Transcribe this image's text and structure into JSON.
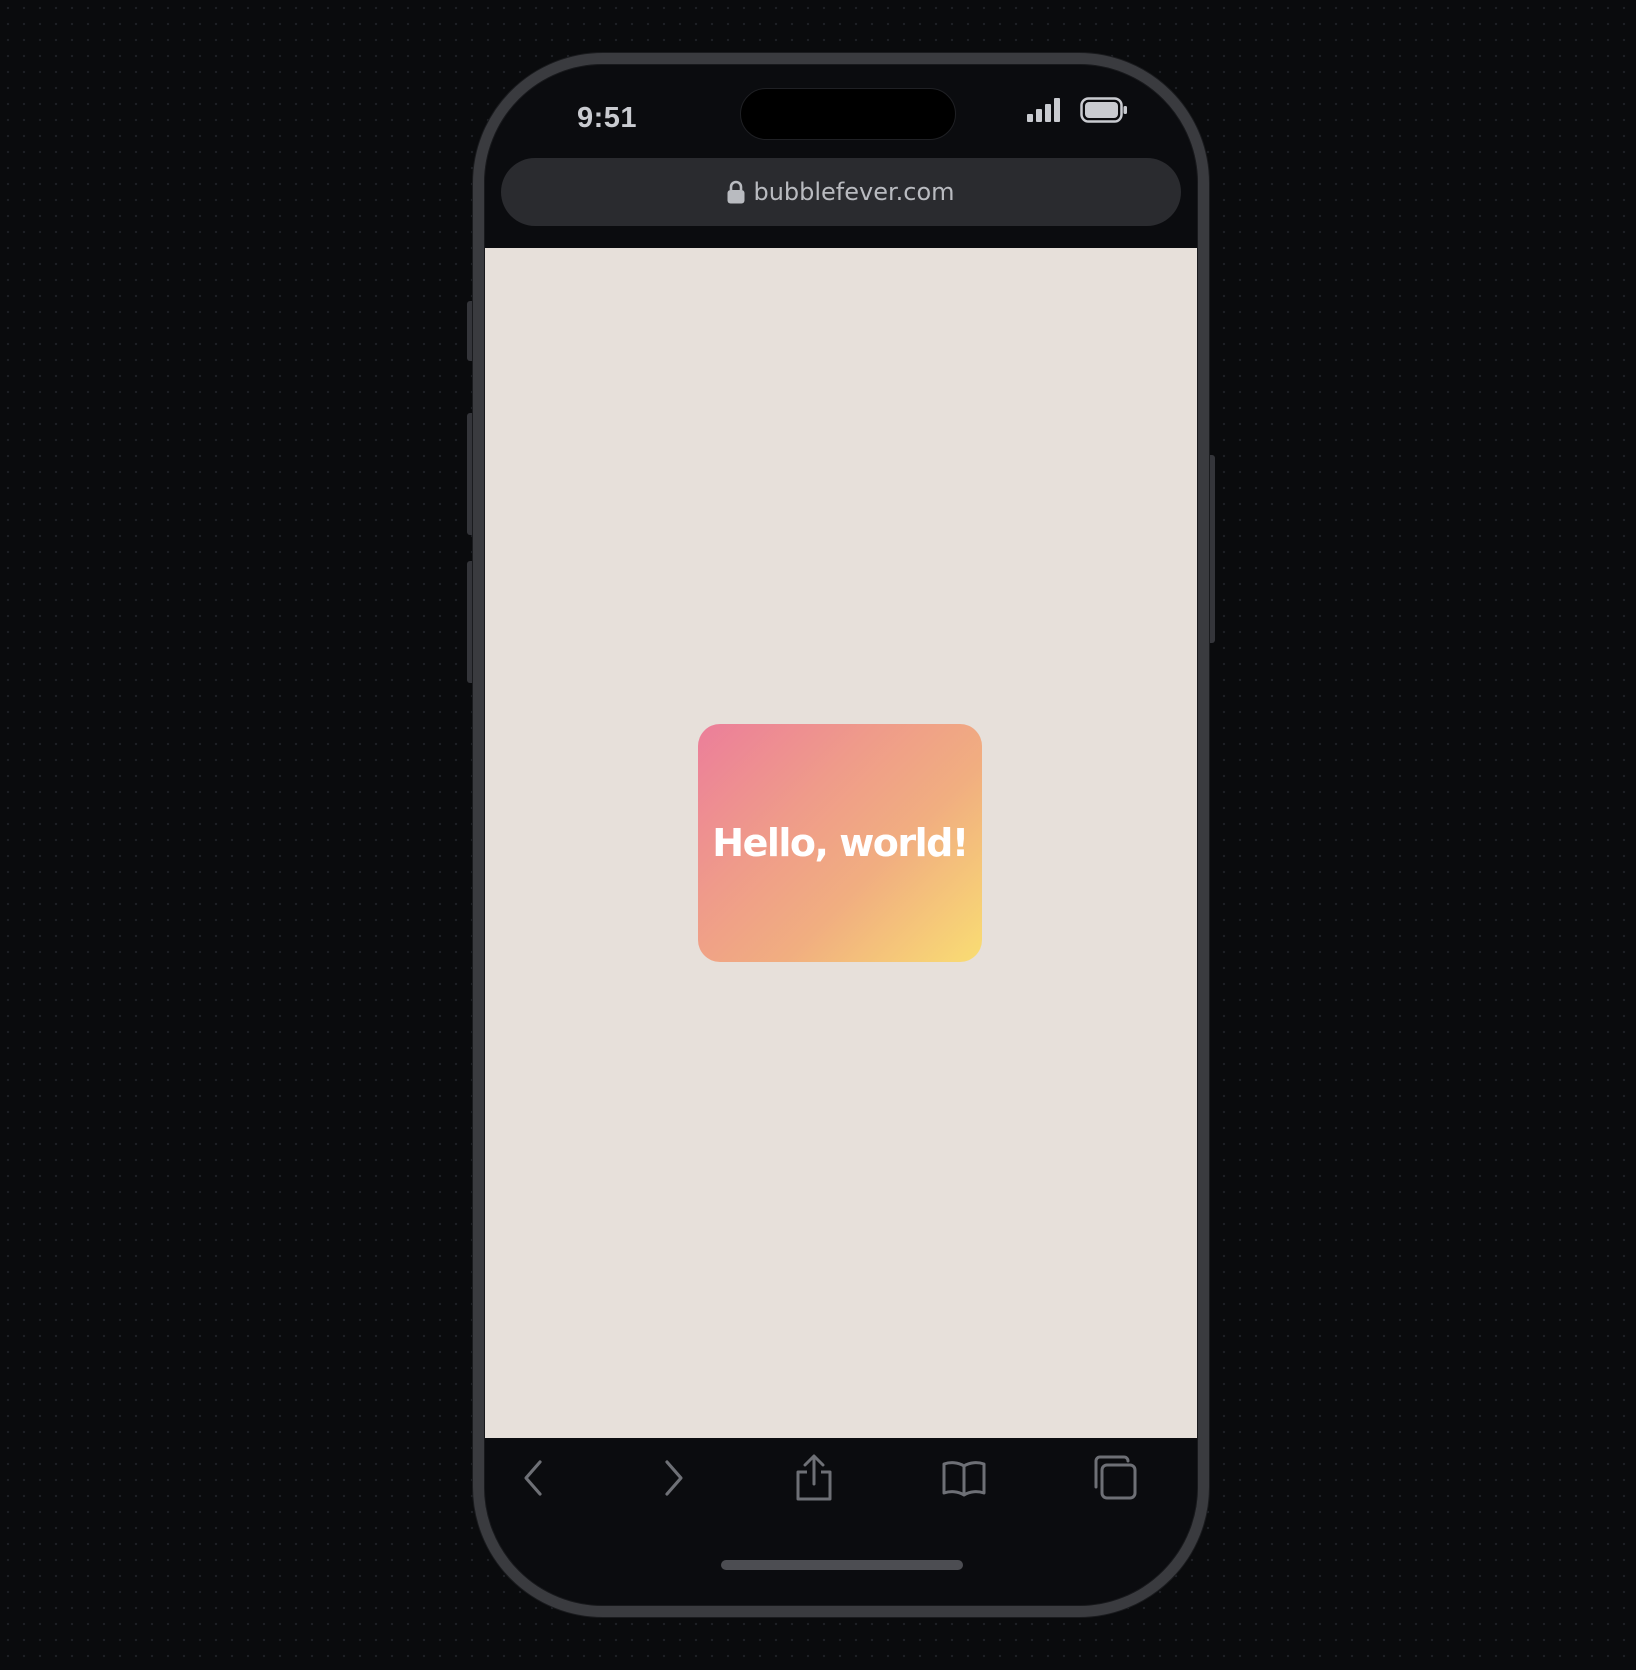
{
  "status_bar": {
    "time": "9:51",
    "signal_icon": "cellular-signal-icon",
    "battery_icon": "battery-icon"
  },
  "browser": {
    "url": "bubblefever.com",
    "lock_icon": "lock-icon"
  },
  "page": {
    "background_color": "#e7e0da",
    "card": {
      "text": "Hello, world!",
      "gradient_colors": [
        "#ec7e9a",
        "#f1ae80",
        "#f9dd73"
      ]
    }
  },
  "toolbar": {
    "buttons": [
      {
        "icon": "chevron-left-icon"
      },
      {
        "icon": "chevron-right-icon"
      },
      {
        "icon": "share-icon"
      },
      {
        "icon": "bookmarks-icon"
      },
      {
        "icon": "tabs-icon"
      }
    ]
  }
}
